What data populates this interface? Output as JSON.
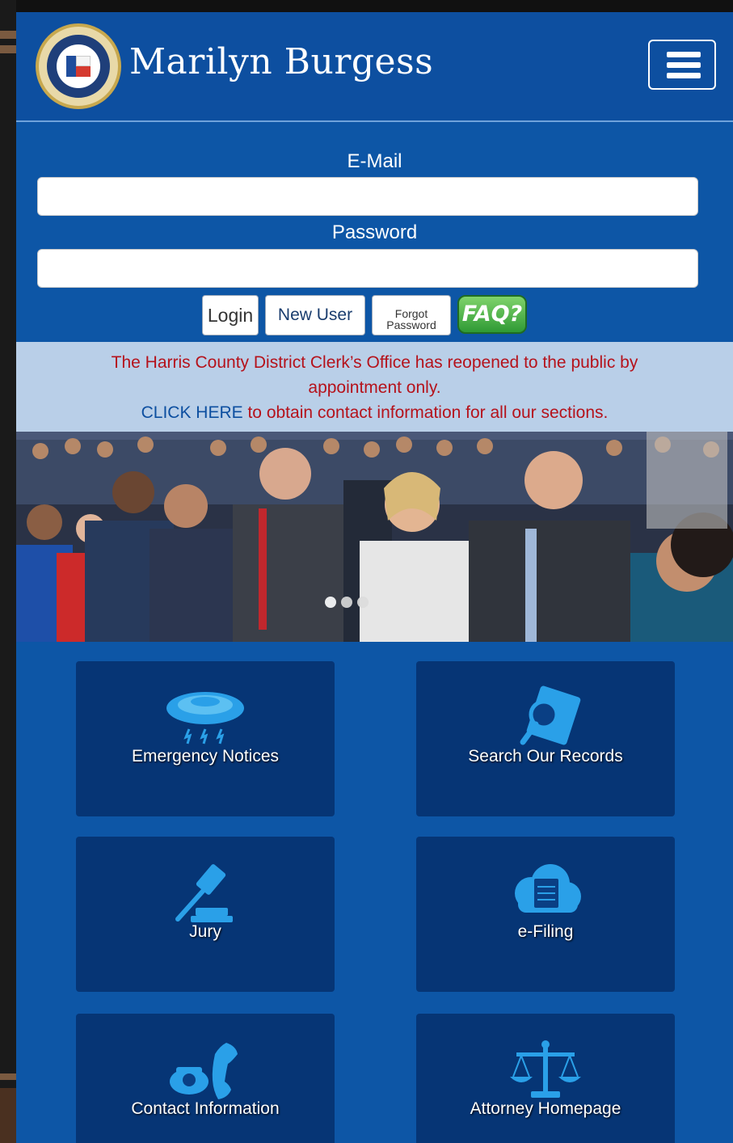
{
  "header": {
    "brand_name": "Marilyn Burgess",
    "seal_text": "DISTRICT CLERK HARRIS COUNTY TEXAS",
    "menu_icon": "hamburger-menu-icon"
  },
  "login": {
    "email_label": "E-Mail",
    "email_value": "",
    "password_label": "Password",
    "password_value": "",
    "login_label": "Login",
    "new_user_label": "New User",
    "forgot_line1": "Forgot",
    "forgot_line2": "Password",
    "faq_label": "FAQ?"
  },
  "notice": {
    "message": "The Harris County District Clerk’s Office has reopened to the public by appointment only.",
    "link_text": "CLICK HERE",
    "link_suffix": " to obtain contact information for all our sections.",
    "message_color": "#b5121b",
    "link_color": "#0d4fa0"
  },
  "carousel": {
    "slide_count": 3,
    "active_slide": 1
  },
  "tiles": [
    {
      "label": "Emergency Notices",
      "icon": "storm-cloud-icon"
    },
    {
      "label": "Search Our Records",
      "icon": "magnifier-document-icon"
    },
    {
      "label": "Jury",
      "icon": "gavel-icon"
    },
    {
      "label": "e-Filing",
      "icon": "cloud-documents-icon"
    },
    {
      "label": "Contact Information",
      "icon": "telephone-icon"
    },
    {
      "label": "Attorney Homepage",
      "icon": "scales-of-justice-icon"
    }
  ],
  "colors": {
    "page_blue": "#0d56a6",
    "tile_blue": "#063575",
    "icon_blue": "#2aa0e8",
    "faq_green": "#2f9a35"
  }
}
